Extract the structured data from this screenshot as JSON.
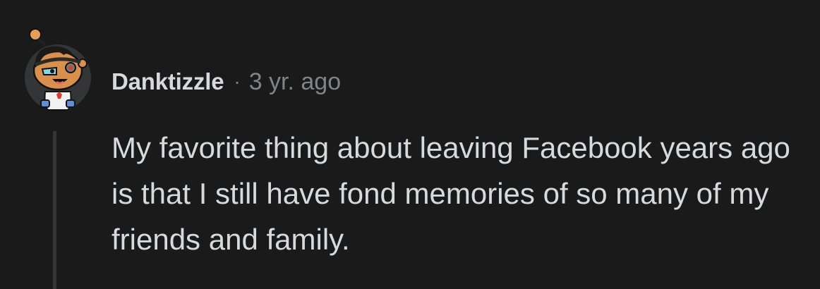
{
  "comment": {
    "author": "Danktizzle",
    "separator": "·",
    "timestamp": "3 yr. ago",
    "body": "My favorite thing about leaving Facebook years ago is that I still have fond memories of so many of my friends and family.",
    "avatar_icon": "snoo-avatar-icon"
  },
  "colors": {
    "background": "#1a1a1b",
    "text": "#d7dadc",
    "meta": "#818384",
    "thread_line": "#343536"
  }
}
